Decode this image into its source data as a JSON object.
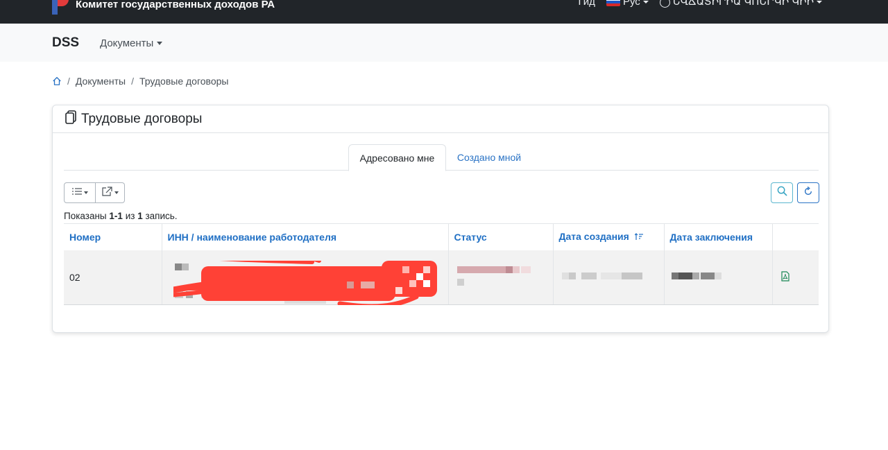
{
  "topbar": {
    "org_name": "Комитет государственных доходов РА",
    "guide_label": "Гид",
    "language_label": "Рус",
    "user_label": "ԵՎՃԱՏԻՐԻԱ ԿՈԵՐԿԻ ԿԻԻ"
  },
  "navbar": {
    "app_name": "DSS",
    "menu_documents": "Документы"
  },
  "breadcrumb": {
    "home_icon": "home-icon",
    "items": [
      "Документы",
      "Трудовые договоры"
    ],
    "separator": "/"
  },
  "card": {
    "title": "Трудовые договоры",
    "title_icon": "documents-icon",
    "tabs": [
      {
        "label": "Адресовано мне",
        "active": true
      },
      {
        "label": "Создано мной",
        "active": false
      }
    ],
    "toolbar": {
      "columns_icon": "list-icon",
      "export_icon": "external-link-icon",
      "search_icon": "search-icon",
      "refresh_icon": "refresh-icon"
    },
    "records": {
      "prefix": "Показаны",
      "range": "1-1",
      "middle": "из",
      "total": "1",
      "suffix": "запись."
    },
    "table": {
      "columns": [
        "Номер",
        "ИНН / наименование работодателя",
        "Статус",
        "Дата создания",
        "Дата заключения",
        ""
      ],
      "rows": [
        {
          "number": "02",
          "employer": "[redacted]",
          "status": "[blurred]",
          "created": "[blurred]",
          "concluded": "[blurred]",
          "action_icon": "pdf-file-icon"
        }
      ]
    }
  },
  "colors": {
    "topbar_bg": "#212529",
    "navbar_bg": "#f8f9fa",
    "link_blue": "#1f6fc4",
    "row_bg": "#f2f2f2",
    "redaction_red": "#ff4136",
    "pdf_green": "#198754"
  }
}
